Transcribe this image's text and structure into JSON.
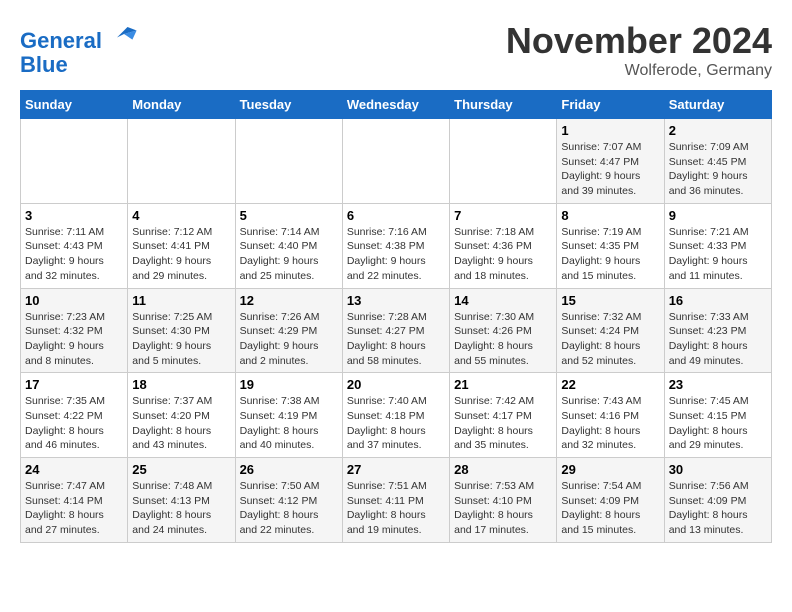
{
  "logo": {
    "line1": "General",
    "line2": "Blue"
  },
  "title": "November 2024",
  "location": "Wolferode, Germany",
  "days_header": [
    "Sunday",
    "Monday",
    "Tuesday",
    "Wednesday",
    "Thursday",
    "Friday",
    "Saturday"
  ],
  "weeks": [
    [
      {
        "day": "",
        "info": ""
      },
      {
        "day": "",
        "info": ""
      },
      {
        "day": "",
        "info": ""
      },
      {
        "day": "",
        "info": ""
      },
      {
        "day": "",
        "info": ""
      },
      {
        "day": "1",
        "info": "Sunrise: 7:07 AM\nSunset: 4:47 PM\nDaylight: 9 hours\nand 39 minutes."
      },
      {
        "day": "2",
        "info": "Sunrise: 7:09 AM\nSunset: 4:45 PM\nDaylight: 9 hours\nand 36 minutes."
      }
    ],
    [
      {
        "day": "3",
        "info": "Sunrise: 7:11 AM\nSunset: 4:43 PM\nDaylight: 9 hours\nand 32 minutes."
      },
      {
        "day": "4",
        "info": "Sunrise: 7:12 AM\nSunset: 4:41 PM\nDaylight: 9 hours\nand 29 minutes."
      },
      {
        "day": "5",
        "info": "Sunrise: 7:14 AM\nSunset: 4:40 PM\nDaylight: 9 hours\nand 25 minutes."
      },
      {
        "day": "6",
        "info": "Sunrise: 7:16 AM\nSunset: 4:38 PM\nDaylight: 9 hours\nand 22 minutes."
      },
      {
        "day": "7",
        "info": "Sunrise: 7:18 AM\nSunset: 4:36 PM\nDaylight: 9 hours\nand 18 minutes."
      },
      {
        "day": "8",
        "info": "Sunrise: 7:19 AM\nSunset: 4:35 PM\nDaylight: 9 hours\nand 15 minutes."
      },
      {
        "day": "9",
        "info": "Sunrise: 7:21 AM\nSunset: 4:33 PM\nDaylight: 9 hours\nand 11 minutes."
      }
    ],
    [
      {
        "day": "10",
        "info": "Sunrise: 7:23 AM\nSunset: 4:32 PM\nDaylight: 9 hours\nand 8 minutes."
      },
      {
        "day": "11",
        "info": "Sunrise: 7:25 AM\nSunset: 4:30 PM\nDaylight: 9 hours\nand 5 minutes."
      },
      {
        "day": "12",
        "info": "Sunrise: 7:26 AM\nSunset: 4:29 PM\nDaylight: 9 hours\nand 2 minutes."
      },
      {
        "day": "13",
        "info": "Sunrise: 7:28 AM\nSunset: 4:27 PM\nDaylight: 8 hours\nand 58 minutes."
      },
      {
        "day": "14",
        "info": "Sunrise: 7:30 AM\nSunset: 4:26 PM\nDaylight: 8 hours\nand 55 minutes."
      },
      {
        "day": "15",
        "info": "Sunrise: 7:32 AM\nSunset: 4:24 PM\nDaylight: 8 hours\nand 52 minutes."
      },
      {
        "day": "16",
        "info": "Sunrise: 7:33 AM\nSunset: 4:23 PM\nDaylight: 8 hours\nand 49 minutes."
      }
    ],
    [
      {
        "day": "17",
        "info": "Sunrise: 7:35 AM\nSunset: 4:22 PM\nDaylight: 8 hours\nand 46 minutes."
      },
      {
        "day": "18",
        "info": "Sunrise: 7:37 AM\nSunset: 4:20 PM\nDaylight: 8 hours\nand 43 minutes."
      },
      {
        "day": "19",
        "info": "Sunrise: 7:38 AM\nSunset: 4:19 PM\nDaylight: 8 hours\nand 40 minutes."
      },
      {
        "day": "20",
        "info": "Sunrise: 7:40 AM\nSunset: 4:18 PM\nDaylight: 8 hours\nand 37 minutes."
      },
      {
        "day": "21",
        "info": "Sunrise: 7:42 AM\nSunset: 4:17 PM\nDaylight: 8 hours\nand 35 minutes."
      },
      {
        "day": "22",
        "info": "Sunrise: 7:43 AM\nSunset: 4:16 PM\nDaylight: 8 hours\nand 32 minutes."
      },
      {
        "day": "23",
        "info": "Sunrise: 7:45 AM\nSunset: 4:15 PM\nDaylight: 8 hours\nand 29 minutes."
      }
    ],
    [
      {
        "day": "24",
        "info": "Sunrise: 7:47 AM\nSunset: 4:14 PM\nDaylight: 8 hours\nand 27 minutes."
      },
      {
        "day": "25",
        "info": "Sunrise: 7:48 AM\nSunset: 4:13 PM\nDaylight: 8 hours\nand 24 minutes."
      },
      {
        "day": "26",
        "info": "Sunrise: 7:50 AM\nSunset: 4:12 PM\nDaylight: 8 hours\nand 22 minutes."
      },
      {
        "day": "27",
        "info": "Sunrise: 7:51 AM\nSunset: 4:11 PM\nDaylight: 8 hours\nand 19 minutes."
      },
      {
        "day": "28",
        "info": "Sunrise: 7:53 AM\nSunset: 4:10 PM\nDaylight: 8 hours\nand 17 minutes."
      },
      {
        "day": "29",
        "info": "Sunrise: 7:54 AM\nSunset: 4:09 PM\nDaylight: 8 hours\nand 15 minutes."
      },
      {
        "day": "30",
        "info": "Sunrise: 7:56 AM\nSunset: 4:09 PM\nDaylight: 8 hours\nand 13 minutes."
      }
    ]
  ]
}
